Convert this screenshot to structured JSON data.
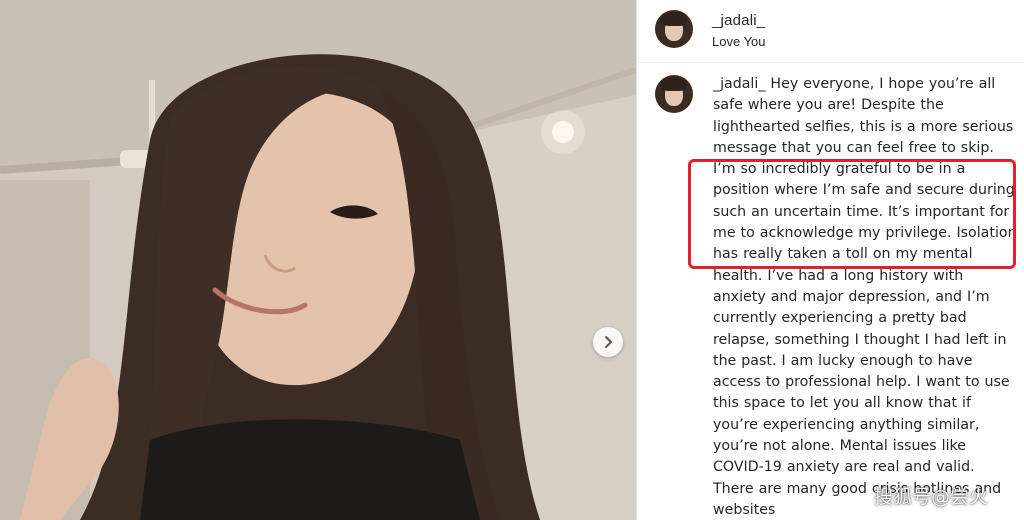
{
  "header": {
    "username": "_jadali_",
    "location": "Love You"
  },
  "caption": {
    "username": "_jadali_",
    "text": "Hey everyone, I hope you’re all safe where you are! Despite the lighthearted selfies, this is a more serious message that you can feel free to skip. I’m so incredibly grateful to be in a position where I’m safe and secure during such an uncertain time. It’s important for me to acknowledge my privilege. Isolation has really taken a toll on my mental health. I’ve had a long history with anxiety and major depression, and I’m currently experiencing a pretty bad relapse, something I thought I had left in the past. I am lucky enough to have access to professional help. I want to use this space to let you all know that if you’re experiencing anything similar, you’re not alone. Mental issues like COVID-19 anxiety are real and valid. There are many good crisis hotlines and websites"
  },
  "watermark": "搜狐号@尝火",
  "icons": {
    "next": "chevron-right-icon"
  },
  "colors": {
    "highlight_border": "#e0212a",
    "text": "#262626"
  }
}
